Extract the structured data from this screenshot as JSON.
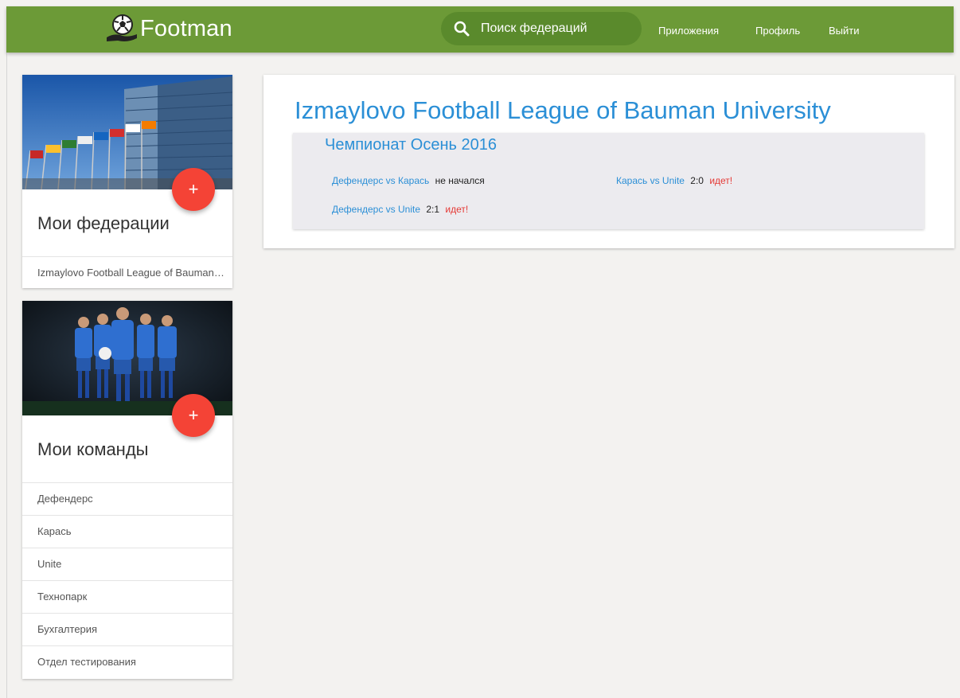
{
  "header": {
    "logo_text": "Footman",
    "search_label": "Поиск федераций",
    "nav": [
      "Приложения",
      "Профиль",
      "Выйти"
    ],
    "brand_color": "#6c9a37"
  },
  "sidebar": {
    "federations": {
      "title": "Мои федерации",
      "add_label": "+",
      "items": [
        "Izmaylovo Football League of Bauman University"
      ]
    },
    "teams": {
      "title": "Мои команды",
      "add_label": "+",
      "items": [
        "Дефендерс",
        "Карась",
        "Unite",
        "Технопарк",
        "Бухгалтерия",
        "Отдел тестирования"
      ]
    }
  },
  "main": {
    "league_title": "Izmaylovo Football League of Bauman University",
    "championship": {
      "title": "Чемпионат Осень 2016",
      "matches": [
        {
          "teams": "Дефендерс vs Карась",
          "score": "",
          "status": "не начался",
          "live": false
        },
        {
          "teams": "Карась vs Unite",
          "score": "2:0",
          "status": "идет!",
          "live": true
        },
        {
          "teams": "Дефендерс vs Unite",
          "score": "2:1",
          "status": "идет!",
          "live": true
        }
      ]
    }
  },
  "colors": {
    "link": "#2b8fd6",
    "live": "#e53935",
    "fab": "#f44336"
  }
}
